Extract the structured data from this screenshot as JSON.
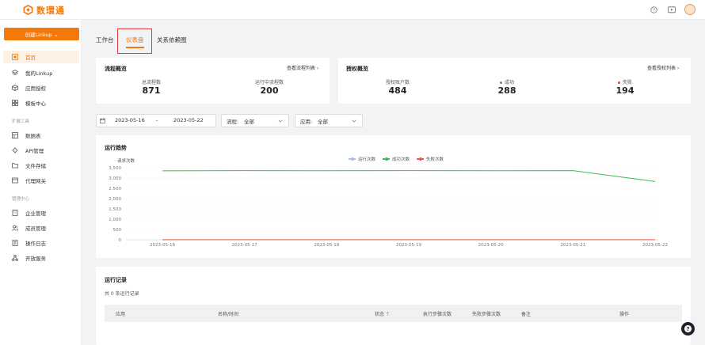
{
  "brand": {
    "name": "数環通",
    "accent": "#f5780a"
  },
  "header": {
    "icons": [
      "help-icon",
      "message-icon",
      "avatar"
    ]
  },
  "sidebar": {
    "create_button": "创建Linkup ⌄",
    "items": [
      {
        "label": "首页",
        "icon": "home-icon",
        "active": true
      },
      {
        "label": "我的Linkup",
        "icon": "layers-icon"
      },
      {
        "label": "应用授权",
        "icon": "cube-icon"
      },
      {
        "label": "模板中心",
        "icon": "grid-icon"
      }
    ],
    "group_extend": "扩展工具",
    "extend_items": [
      {
        "label": "数据表",
        "icon": "table-icon"
      },
      {
        "label": "API管理",
        "icon": "api-icon"
      },
      {
        "label": "文件存储",
        "icon": "folder-icon"
      },
      {
        "label": "代理网关",
        "icon": "gateway-icon"
      }
    ],
    "group_manage": "管理中心",
    "manage_items": [
      {
        "label": "企业管理",
        "icon": "building-icon"
      },
      {
        "label": "成员管理",
        "icon": "users-icon"
      },
      {
        "label": "操作日志",
        "icon": "log-icon"
      },
      {
        "label": "开放服务",
        "icon": "share-icon"
      }
    ]
  },
  "tabs": [
    {
      "label": "工作台"
    },
    {
      "label": "仪表盘",
      "active": true
    },
    {
      "label": "关系依赖图"
    }
  ],
  "flow_overview": {
    "title": "流程概览",
    "link": "查看流程列表 ›",
    "stats": [
      {
        "label": "总流程数",
        "value": "871"
      },
      {
        "label": "运行中流程数",
        "value": "200"
      }
    ]
  },
  "auth_overview": {
    "title": "授权概览",
    "link": "查看授权列表 ›",
    "stats": [
      {
        "label": "授权账户数",
        "value": "484"
      },
      {
        "label": "成功",
        "value": "288",
        "color": "#2fae5a"
      },
      {
        "label": "失败",
        "value": "194",
        "color": "#e0453a"
      }
    ]
  },
  "filters": {
    "date_start": "2023-05-16",
    "date_sep": "-",
    "date_end": "2023-05-22",
    "flow_label": "流程:",
    "flow_value": "全部",
    "app_label": "应用:",
    "app_value": "全部"
  },
  "chart_data": {
    "type": "line",
    "title": "运行趋势",
    "ylabel": "请求次数",
    "x": [
      "2023-05-16",
      "2023-05-17",
      "2023-05-18",
      "2023-05-19",
      "2023-05-20",
      "2023-05-21",
      "2023-05-22"
    ],
    "y_ticks": [
      0,
      500,
      1000,
      1500,
      2000,
      2500,
      3000,
      3500
    ],
    "y_tick_labels": [
      "0",
      "500",
      "1,000",
      "1,500",
      "2,000",
      "2,500",
      "3,000",
      "3,500"
    ],
    "ylim": [
      0,
      3500
    ],
    "legend_position": "top-center",
    "grid": true,
    "series": [
      {
        "name": "运行次数",
        "color": "#a9bde8",
        "values": [
          0,
          0,
          0,
          0,
          0,
          0,
          0
        ]
      },
      {
        "name": "成功次数",
        "color": "#3fb950",
        "values": [
          3350,
          3360,
          3355,
          3360,
          3355,
          3360,
          2830
        ]
      },
      {
        "name": "失败次数",
        "color": "#e85a4a",
        "values": [
          5,
          5,
          5,
          5,
          5,
          5,
          5
        ]
      }
    ]
  },
  "records": {
    "title": "运行记录",
    "count_text": "共 0 条运行记录",
    "columns": [
      "应用",
      "名称/时间",
      "状态 ⊤",
      "执行步骤次数",
      "失败步骤次数",
      "备注",
      "操作"
    ]
  }
}
